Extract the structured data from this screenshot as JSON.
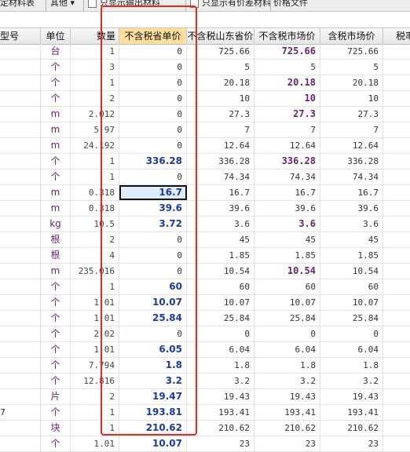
{
  "toolbar": {
    "left_label": "定材料表",
    "dropdown_label": "其他",
    "check1_label": "只显示输出材料",
    "check2_label": "只显示有价差材料",
    "right_label": "价格文件"
  },
  "columns": [
    {
      "label": "型号"
    },
    {
      "label": "单位"
    },
    {
      "label": "数量"
    },
    {
      "label": "不含税省单价",
      "active": true
    },
    {
      "label": "不含税山东省价"
    },
    {
      "label": "不含税市场价"
    },
    {
      "label": "含税市场价"
    },
    {
      "label": "税率"
    }
  ],
  "rows": [
    {
      "model": "",
      "unit": "台",
      "qty": "1",
      "excl": "0",
      "excl_bold": false,
      "sd": "725.66",
      "mkt": "725.66",
      "mkt_bold": true,
      "incl": "725.66"
    },
    {
      "model": "",
      "unit": "个",
      "qty": "3",
      "excl": "0",
      "excl_bold": false,
      "sd": "5",
      "mkt": "5",
      "mkt_bold": false,
      "incl": "5"
    },
    {
      "model": "",
      "unit": "个",
      "qty": "1",
      "excl": "0",
      "excl_bold": false,
      "sd": "20.18",
      "mkt": "20.18",
      "mkt_bold": true,
      "incl": "20.18"
    },
    {
      "model": "",
      "unit": "个",
      "qty": "2",
      "excl": "0",
      "excl_bold": false,
      "sd": "10",
      "mkt": "10",
      "mkt_bold": true,
      "incl": "10"
    },
    {
      "model": "",
      "unit": "m",
      "qty": "2.012",
      "excl": "0",
      "excl_bold": false,
      "sd": "27.3",
      "mkt": "27.3",
      "mkt_bold": true,
      "incl": "27.3"
    },
    {
      "model": "",
      "unit": "m",
      "qty": "5.97",
      "excl": "0",
      "excl_bold": false,
      "sd": "7",
      "mkt": "7",
      "mkt_bold": false,
      "incl": "7"
    },
    {
      "model": "",
      "unit": "m",
      "qty": "24.192",
      "excl": "0",
      "excl_bold": false,
      "sd": "12.64",
      "mkt": "12.64",
      "mkt_bold": false,
      "incl": "12.64"
    },
    {
      "model": "",
      "unit": "个",
      "qty": "1",
      "excl": "336.28",
      "excl_bold": true,
      "sd": "336.28",
      "mkt": "336.28",
      "mkt_bold": true,
      "incl": "336.28"
    },
    {
      "model": "",
      "unit": "个",
      "qty": "1",
      "excl": "0",
      "excl_bold": false,
      "sd": "74.34",
      "mkt": "74.34",
      "mkt_bold": false,
      "incl": "74.34"
    },
    {
      "model": "",
      "unit": "m",
      "qty": "0.318",
      "excl": "16.7",
      "excl_bold": true,
      "selected": true,
      "sd": "16.7",
      "mkt": "16.7",
      "mkt_bold": false,
      "incl": "16.7"
    },
    {
      "model": "",
      "unit": "m",
      "qty": "0.318",
      "excl": "39.6",
      "excl_bold": true,
      "sd": "39.6",
      "mkt": "39.6",
      "mkt_bold": false,
      "incl": "39.6"
    },
    {
      "model": "",
      "unit": "kg",
      "qty": "10.5",
      "excl": "3.72",
      "excl_bold": true,
      "sd": "3.6",
      "mkt": "3.6",
      "mkt_bold": true,
      "incl": "3.6"
    },
    {
      "model": "",
      "unit": "根",
      "qty": "2",
      "excl": "0",
      "excl_bold": false,
      "sd": "45",
      "mkt": "45",
      "mkt_bold": false,
      "incl": "45"
    },
    {
      "model": "",
      "unit": "根",
      "qty": "4",
      "excl": "0",
      "excl_bold": false,
      "sd": "1.85",
      "mkt": "1.85",
      "mkt_bold": false,
      "incl": "1.85"
    },
    {
      "model": "",
      "unit": "m",
      "qty": "235.016",
      "excl": "0",
      "excl_bold": false,
      "sd": "10.54",
      "mkt": "10.54",
      "mkt_bold": true,
      "incl": "10.54"
    },
    {
      "model": "",
      "unit": "个",
      "qty": "1",
      "excl": "60",
      "excl_bold": true,
      "sd": "60",
      "mkt": "60",
      "mkt_bold": false,
      "incl": "60"
    },
    {
      "model": "",
      "unit": "个",
      "qty": "1.01",
      "excl": "10.07",
      "excl_bold": true,
      "sd": "10.07",
      "mkt": "10.07",
      "mkt_bold": false,
      "incl": "10.07"
    },
    {
      "model": "",
      "unit": "个",
      "qty": "1.01",
      "excl": "25.84",
      "excl_bold": true,
      "sd": "25.84",
      "mkt": "25.84",
      "mkt_bold": false,
      "incl": "25.84"
    },
    {
      "model": "",
      "unit": "个",
      "qty": "2.02",
      "excl": "0",
      "excl_bold": false,
      "sd": "0",
      "mkt": "0",
      "mkt_bold": false,
      "incl": "0"
    },
    {
      "model": "",
      "unit": "个",
      "qty": "1.01",
      "excl": "6.05",
      "excl_bold": true,
      "sd": "6.04",
      "mkt": "6.04",
      "mkt_bold": false,
      "incl": "6.04"
    },
    {
      "model": "",
      "unit": "个",
      "qty": "7.794",
      "excl": "1.8",
      "excl_bold": true,
      "sd": "1.8",
      "mkt": "1.8",
      "mkt_bold": false,
      "incl": "1.8"
    },
    {
      "model": "",
      "unit": "个",
      "qty": "12.816",
      "excl": "3.2",
      "excl_bold": true,
      "sd": "3.2",
      "mkt": "3.2",
      "mkt_bold": false,
      "incl": "3.2"
    },
    {
      "model": "",
      "unit": "片",
      "qty": "2",
      "excl": "19.47",
      "excl_bold": true,
      "sd": "19.43",
      "mkt": "19.43",
      "mkt_bold": false,
      "incl": "19.43"
    },
    {
      "model": "7",
      "unit": "个",
      "qty": "1",
      "excl": "193.81",
      "excl_bold": true,
      "sd": "193.41",
      "mkt": "193.41",
      "mkt_bold": false,
      "incl": "193.41"
    },
    {
      "model": "",
      "unit": "块",
      "qty": "1",
      "excl": "210.62",
      "excl_bold": true,
      "sd": "210.62",
      "mkt": "210.62",
      "mkt_bold": false,
      "incl": "210.62"
    },
    {
      "model": "",
      "unit": "个",
      "qty": "1.01",
      "excl": "10.07",
      "excl_bold": true,
      "sd": "23",
      "mkt": "23",
      "mkt_bold": false,
      "incl": "23"
    }
  ]
}
